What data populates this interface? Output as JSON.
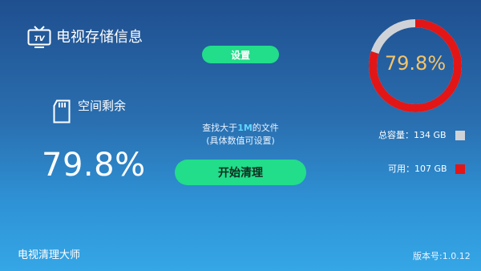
{
  "header": {
    "title": "电视存储信息",
    "tv_icon_text": "TV"
  },
  "toolbar": {
    "settings_label": "设置"
  },
  "storage": {
    "space_label": "空间剩余",
    "remaining_percent_text": "79.8%",
    "ring_percent_text": "79.8%",
    "used_fraction": 0.2
  },
  "hint": {
    "prefix": "查找大于",
    "size": "1M",
    "suffix": "的文件",
    "line2": "(具体数值可设置)"
  },
  "actions": {
    "start_label": "开始清理"
  },
  "legend": {
    "total_text": "总容量：134 GB",
    "available_text": "可用：107 GB",
    "total_color": "#cfd3d8",
    "available_color": "#e21616"
  },
  "footer": {
    "app_name": "电视清理大师",
    "version": "版本号:1.0.12"
  },
  "icons": [
    "tv-icon",
    "sd-card-icon"
  ]
}
